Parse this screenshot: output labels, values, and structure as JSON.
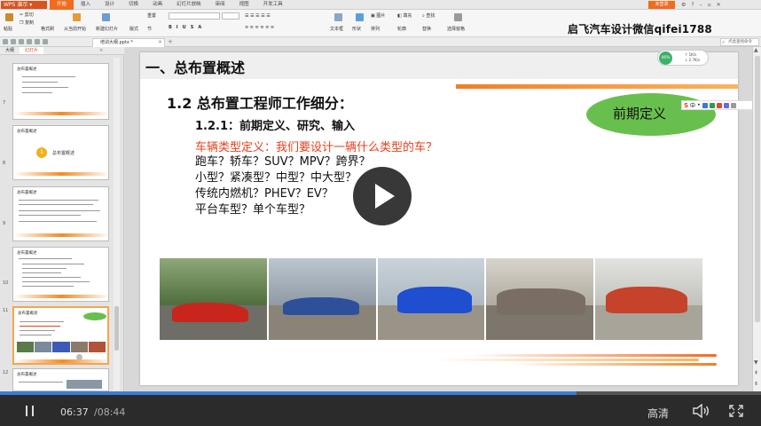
{
  "app": {
    "name": "WPS 演示",
    "menu_tabs": [
      "开始",
      "插入",
      "设计",
      "切换",
      "动画",
      "幻灯片放映",
      "审阅",
      "视图",
      "开发工具"
    ],
    "active_tab": "开始",
    "login_label": "未登录"
  },
  "ribbon": {
    "cut": "剪切",
    "copy": "复制",
    "paste": "粘贴",
    "format_painter": "格式刷",
    "play_from_start": "从当前开始",
    "new_slide": "新建幻灯片",
    "layout": "版式",
    "section": "节",
    "reset": "重置",
    "textbox": "文本框",
    "shape": "形状",
    "arrange": "排列",
    "outline": "轮廓",
    "replace": "替换",
    "select_pane": "选择窗格",
    "picture": "图片",
    "fill": "填充",
    "find": "查找"
  },
  "watermark": "启飞汽车设计微信qifei1788",
  "file_tab": "培训大纲.pptx *",
  "search_placeholder": "点此查找命令",
  "left_panel": {
    "tabs": [
      "大纲",
      "幻灯片"
    ],
    "active_tab": "幻灯片",
    "slide_numbers": [
      "7",
      "8",
      "9",
      "10",
      "11",
      "12"
    ],
    "thumb_titles": [
      "总布置概述",
      "总布置概述",
      "总布置概述",
      "总布置概述",
      "总布置概述",
      "总布置概述"
    ],
    "thumb_section_label": "总布置概述"
  },
  "slide": {
    "section_title": "一、总布置概述",
    "heading": "1.2 总布置工程师工作细分：",
    "subheading": "1.2.1：前期定义、研究、输入",
    "question": "车辆类型定义：我们要设计一辆什么类型的车？",
    "lines": [
      "跑车？轿车？SUV？MPV？跨界？",
      "小型？紧凑型？中型？中大型？",
      "传统内燃机？PHEV？EV？",
      "平台车型？单个车型？"
    ],
    "badge": "前期定义"
  },
  "net_widget": {
    "percent": "46%",
    "up": "1K/s",
    "down": "2.7K/s"
  },
  "video": {
    "current_time": "06:37",
    "total_time": "/08:44",
    "progress": 0.758,
    "quality": "高清"
  },
  "colors": {
    "accent_orange": "#f26b21",
    "question_red": "#e8401c",
    "badge_green": "#69bf4d",
    "progress_blue": "#3a7fd6"
  }
}
